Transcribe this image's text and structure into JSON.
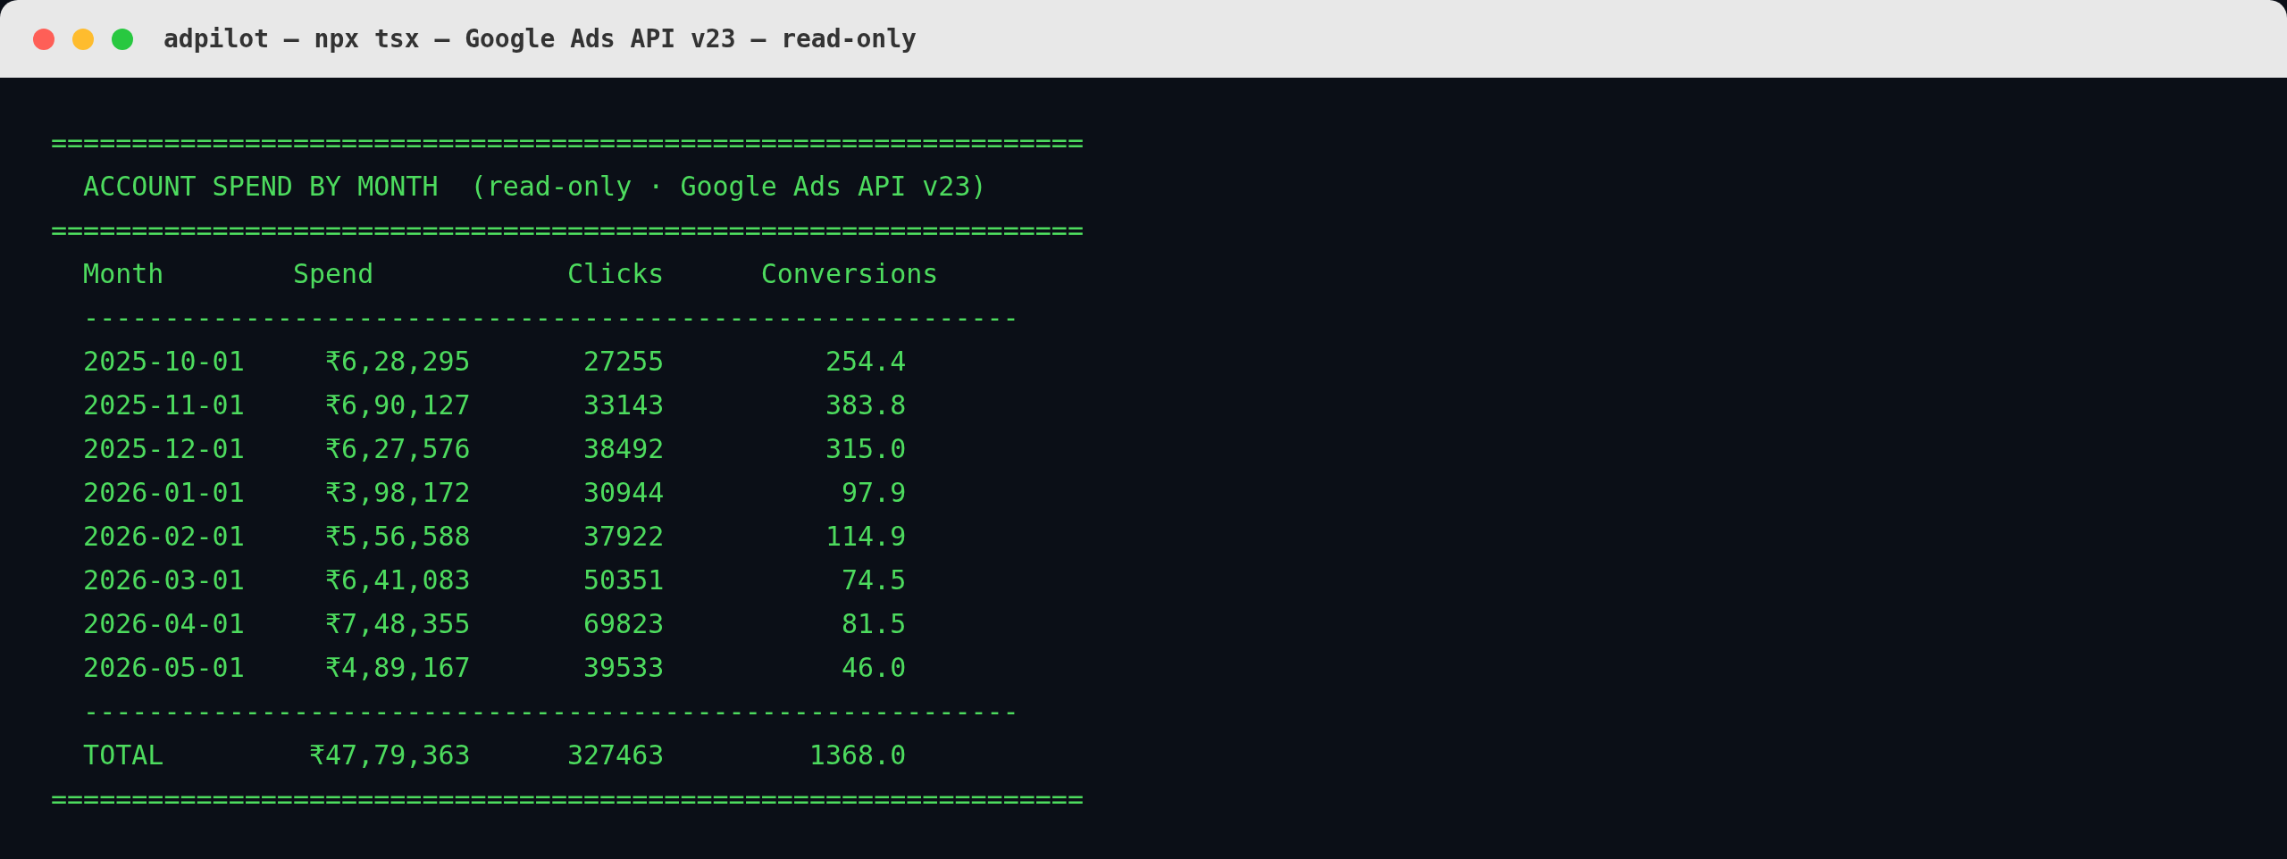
{
  "window": {
    "title": "adpilot — npx tsx — Google Ads API v23 — read-only"
  },
  "report": {
    "rule_top": "================================================================",
    "title": "ACCOUNT SPEND BY MONTH  (read-only · Google Ads API v23)",
    "rule_mid": "================================================================",
    "columns": [
      "Month",
      "Spend",
      "Clicks",
      "Conversions"
    ],
    "divider_top": "----------------------------------------------------------",
    "rows": [
      {
        "month": "2025-10-01",
        "spend": "₹6,28,295",
        "clicks": "27255",
        "conversions": "254.4"
      },
      {
        "month": "2025-11-01",
        "spend": "₹6,90,127",
        "clicks": "33143",
        "conversions": "383.8"
      },
      {
        "month": "2025-12-01",
        "spend": "₹6,27,576",
        "clicks": "38492",
        "conversions": "315.0"
      },
      {
        "month": "2026-01-01",
        "spend": "₹3,98,172",
        "clicks": "30944",
        "conversions": "97.9"
      },
      {
        "month": "2026-02-01",
        "spend": "₹5,56,588",
        "clicks": "37922",
        "conversions": "114.9"
      },
      {
        "month": "2026-03-01",
        "spend": "₹6,41,083",
        "clicks": "50351",
        "conversions": "74.5"
      },
      {
        "month": "2026-04-01",
        "spend": "₹7,48,355",
        "clicks": "69823",
        "conversions": "81.5"
      },
      {
        "month": "2026-05-01",
        "spend": "₹4,89,167",
        "clicks": "39533",
        "conversions": "46.0"
      }
    ],
    "divider_bottom": "----------------------------------------------------------",
    "total": {
      "month": "TOTAL",
      "spend": "₹47,79,363",
      "clicks": "327463",
      "conversions": "1368.0"
    },
    "rule_bottom": "================================================================"
  }
}
